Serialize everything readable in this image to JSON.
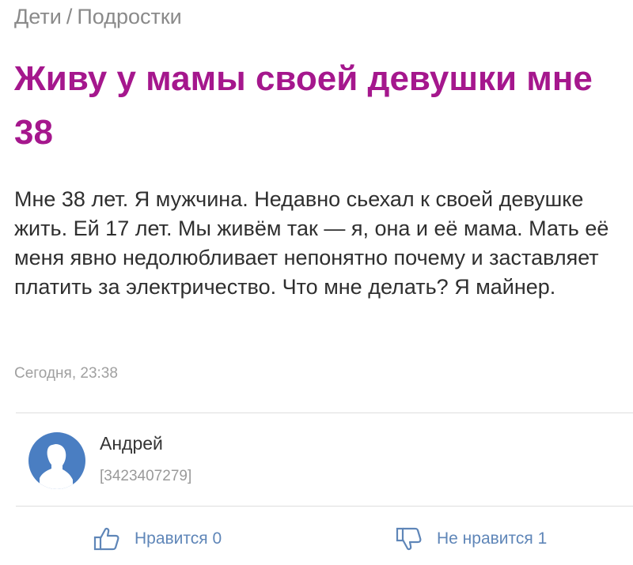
{
  "breadcrumb": {
    "first": "Дети",
    "separator": "/",
    "second": "Подростки"
  },
  "post": {
    "title": "Живу у мамы своей девушки мне 38",
    "body": "Мне 38 лет. Я мужчина. Недавно сьехал к своей девушке жить. Ей 17 лет. Мы живём так — я, она и её мама. Мать её меня явно недолюбливает непонятно почему и заставляет платить за электричество. Что мне делать? Я майнер.",
    "timestamp": "Сегодня, 23:38"
  },
  "author": {
    "name": "Андрей",
    "id": "[3423407279]",
    "avatar_icon": "user-silhouette-icon"
  },
  "reactions": {
    "like_label": "Нравится 0",
    "like_icon": "thumbs-up-icon",
    "dislike_label": "Не нравится 1",
    "dislike_icon": "thumbs-down-icon"
  },
  "colors": {
    "title": "#a5178d",
    "avatar": "#4a7ec2",
    "reaction": "#5f86b8"
  }
}
